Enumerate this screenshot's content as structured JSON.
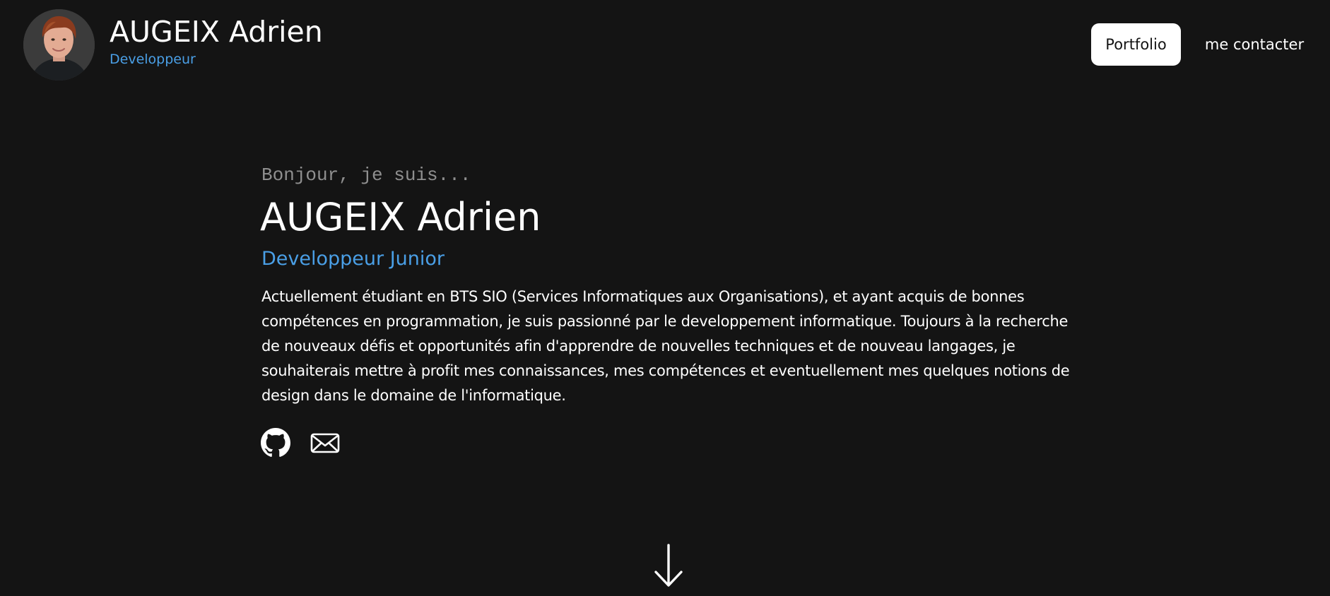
{
  "header": {
    "avatar_alt": "photo de profil",
    "name": "AUGEIX Adrien",
    "role": "Developpeur"
  },
  "nav": {
    "items": [
      {
        "label": "Portfolio",
        "active": true
      },
      {
        "label": "me contacter",
        "active": false
      }
    ]
  },
  "hero": {
    "greeting": "Bonjour, je suis...",
    "name": "AUGEIX Adrien",
    "title": "Developpeur Junior",
    "bio": "Actuellement étudiant en BTS SIO (Services Informatiques aux Organisations), et ayant acquis de bonnes compétences en programmation, je suis passionné par le developpement informatique. Toujours à la recherche de nouveaux défis et opportunités afin d'apprendre de nouvelles techniques et de nouveau langages, je souhaiterais mettre à profit mes connaissances, mes compétences et eventuellement mes quelques notions de design dans le domaine de l'informatique."
  },
  "social": [
    {
      "icon": "github-icon"
    },
    {
      "icon": "mail-icon"
    }
  ],
  "scroll": {
    "icon": "arrow-down-icon"
  },
  "colors": {
    "background": "#141414",
    "accent": "#4a9fe6",
    "text": "#ffffff",
    "muted": "#8f8f8f"
  }
}
